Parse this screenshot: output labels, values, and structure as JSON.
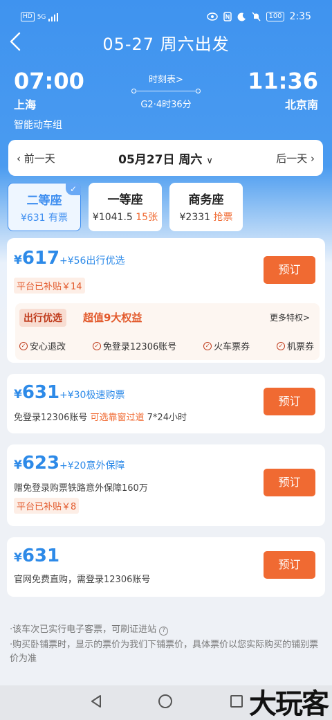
{
  "status": {
    "left_hd": "HD",
    "left_net": "5G",
    "time": "2:35",
    "battery": "100"
  },
  "nav": {
    "title": "05-27 周六出发"
  },
  "train": {
    "dep_time": "07:00",
    "dep_station": "上海",
    "arr_time": "11:36",
    "arr_station": "北京南",
    "timetable": "时刻表>",
    "info": "G2·4时36分",
    "type": "智能动车组"
  },
  "datebar": {
    "prev": "前一天",
    "current": "05月27日 周六",
    "next": "后一天"
  },
  "seats": [
    {
      "name": "二等座",
      "price": "¥631",
      "avail": "有票"
    },
    {
      "name": "一等座",
      "price": "¥1041.5",
      "avail": "15张"
    },
    {
      "name": "商务座",
      "price": "¥2331",
      "avail": "抢票"
    }
  ],
  "options": [
    {
      "yen": "¥",
      "price": "617",
      "extra": "+¥56出行优选",
      "subsidy": "平台已补贴￥14",
      "book": "预订"
    },
    {
      "yen": "¥",
      "price": "631",
      "extra": "+¥30极速购票",
      "desc1": "免登录12306账号",
      "desc2": "可选靠窗过道",
      "desc3": "7*24小时",
      "book": "预订"
    },
    {
      "yen": "¥",
      "price": "623",
      "extra": "+¥20意外保障",
      "desc": "赠免登录购票铁路意外保障160万",
      "subsidy": "平台已补贴￥8",
      "book": "预订"
    },
    {
      "yen": "¥",
      "price": "631",
      "desc": "官网免费直购，需登录12306账号",
      "book": "预订"
    }
  ],
  "benefit": {
    "tag": "出行优选",
    "headline": "超值9大权益",
    "more": "更多特权>",
    "items": [
      "安心退改",
      "免登录12306账号",
      "火车票券",
      "机票券"
    ]
  },
  "notes": [
    "·该车次已实行电子客票，可刷证进站",
    "·购买卧铺票时，显示的票价为我们下铺票价，具体票价以您实际购买的铺别票价为准"
  ],
  "watermark": "大玩客"
}
